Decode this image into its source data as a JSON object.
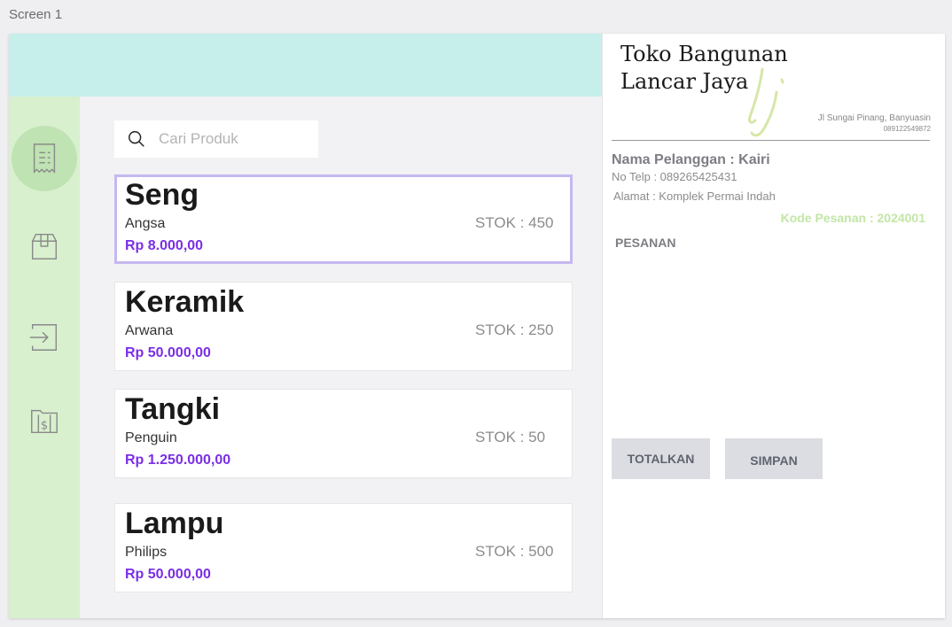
{
  "screen_label": "Screen 1",
  "sidebar": {
    "items": [
      {
        "icon": "receipt-icon",
        "active": true
      },
      {
        "icon": "box-icon",
        "active": false
      },
      {
        "icon": "login-icon",
        "active": false
      },
      {
        "icon": "money-folder-icon",
        "active": false
      }
    ]
  },
  "search": {
    "placeholder": "Cari Produk",
    "value": ""
  },
  "products": [
    {
      "name": "Seng",
      "brand": "Angsa",
      "price": "Rp 8.000,00",
      "stock": "STOK : 450",
      "selected": true
    },
    {
      "name": "Keramik",
      "brand": "Arwana",
      "price": "Rp 50.000,00",
      "stock": "STOK : 250",
      "selected": false
    },
    {
      "name": "Tangki",
      "brand": "Penguin",
      "price": "Rp 1.250.000,00",
      "stock": "STOK : 50",
      "selected": false
    },
    {
      "name": "Lampu",
      "brand": "Philips",
      "price": "Rp 50.000,00",
      "stock": "STOK : 500",
      "selected": false
    }
  ],
  "receipt": {
    "store_name_line1": "Toko Bangunan",
    "store_name_line2": "Lancar Jaya",
    "logo_text": "Lj",
    "address": "Jl Sungai Pinang, Banyuasin",
    "phone": "089122549872",
    "customer_name": "Nama Pelanggan : Kairi",
    "customer_phone": "No Telp : 089265425431",
    "customer_address": "Alamat : Komplek Permai Indah",
    "order_code": "Kode Pesanan : 2024001",
    "orders_label": "PESANAN",
    "total_button": "TOTALKAN",
    "save_button": "SIMPAN"
  },
  "colors": {
    "topbar": "#c6efec",
    "sidebar": "#d8f0ce",
    "price": "#7a2ee6",
    "selected_border": "#c5b8f0",
    "order_code": "#c2e6a6"
  }
}
